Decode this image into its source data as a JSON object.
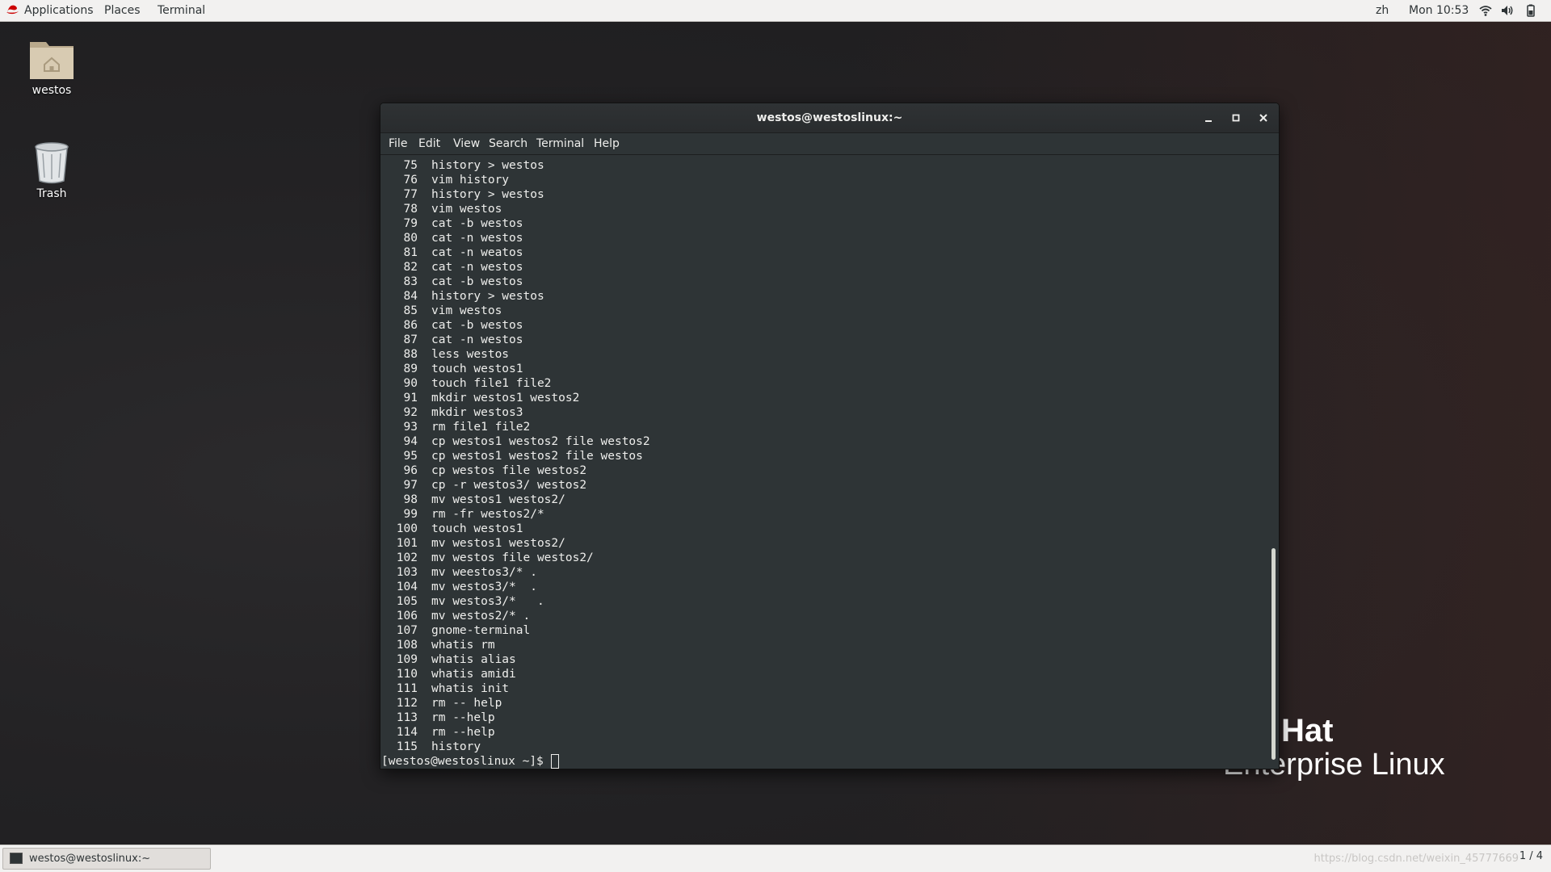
{
  "topbar": {
    "applications": "Applications",
    "places": "Places",
    "terminal": "Terminal",
    "input_method": "zh",
    "clock": "Mon 10:53",
    "icons": [
      "redhat-logo-icon",
      "wifi-icon",
      "volume-icon",
      "battery-icon"
    ]
  },
  "desktop": {
    "home_label": "westos",
    "trash_label": "Trash"
  },
  "brand": {
    "line1": "Hat",
    "line2": "Enterprise Linux"
  },
  "window": {
    "title": "westos@westoslinux:~",
    "buttons": {
      "minimize": "–",
      "maximize": "□",
      "close": "✕"
    },
    "menu": {
      "file": "File",
      "edit": "Edit",
      "view": "View",
      "search": "Search",
      "terminal": "Terminal",
      "help": "Help"
    }
  },
  "terminal": {
    "history": [
      {
        "num": "75",
        "cmd": "history > westos"
      },
      {
        "num": "76",
        "cmd": "vim history"
      },
      {
        "num": "77",
        "cmd": "history > westos"
      },
      {
        "num": "78",
        "cmd": "vim westos"
      },
      {
        "num": "79",
        "cmd": "cat -b westos"
      },
      {
        "num": "80",
        "cmd": "cat -n westos"
      },
      {
        "num": "81",
        "cmd": "cat -n weatos"
      },
      {
        "num": "82",
        "cmd": "cat -n westos"
      },
      {
        "num": "83",
        "cmd": "cat -b westos"
      },
      {
        "num": "84",
        "cmd": "history > westos"
      },
      {
        "num": "85",
        "cmd": "vim westos"
      },
      {
        "num": "86",
        "cmd": "cat -b westos"
      },
      {
        "num": "87",
        "cmd": "cat -n westos"
      },
      {
        "num": "88",
        "cmd": "less westos"
      },
      {
        "num": "89",
        "cmd": "touch westos1"
      },
      {
        "num": "90",
        "cmd": "touch file1 file2"
      },
      {
        "num": "91",
        "cmd": "mkdir westos1 westos2"
      },
      {
        "num": "92",
        "cmd": "mkdir westos3"
      },
      {
        "num": "93",
        "cmd": "rm file1 file2"
      },
      {
        "num": "94",
        "cmd": "cp westos1 westos2 file westos2"
      },
      {
        "num": "95",
        "cmd": "cp westos1 westos2 file westos"
      },
      {
        "num": "96",
        "cmd": "cp westos file westos2"
      },
      {
        "num": "97",
        "cmd": "cp -r westos3/ westos2"
      },
      {
        "num": "98",
        "cmd": "mv westos1 westos2/"
      },
      {
        "num": "99",
        "cmd": "rm -fr westos2/*"
      },
      {
        "num": "100",
        "cmd": "touch westos1"
      },
      {
        "num": "101",
        "cmd": "mv westos1 westos2/"
      },
      {
        "num": "102",
        "cmd": "mv westos file westos2/"
      },
      {
        "num": "103",
        "cmd": "mv weestos3/* ."
      },
      {
        "num": "104",
        "cmd": "mv westos3/*  ."
      },
      {
        "num": "105",
        "cmd": "mv westos3/*   ."
      },
      {
        "num": "106",
        "cmd": "mv westos2/* ."
      },
      {
        "num": "107",
        "cmd": "gnome-terminal"
      },
      {
        "num": "108",
        "cmd": "whatis rm"
      },
      {
        "num": "109",
        "cmd": "whatis alias"
      },
      {
        "num": "110",
        "cmd": "whatis amidi"
      },
      {
        "num": "111",
        "cmd": "whatis init"
      },
      {
        "num": "112",
        "cmd": "rm -- help"
      },
      {
        "num": "113",
        "cmd": "rm --help"
      },
      {
        "num": "114",
        "cmd": "rm --help"
      },
      {
        "num": "115",
        "cmd": "history"
      }
    ],
    "prompt": "[westos@westoslinux ~]$ "
  },
  "taskbar": {
    "task_label": "westos@westoslinux:~",
    "workspace": "1 / 4",
    "watermark": "https://blog.csdn.net/weixin_45777669"
  }
}
